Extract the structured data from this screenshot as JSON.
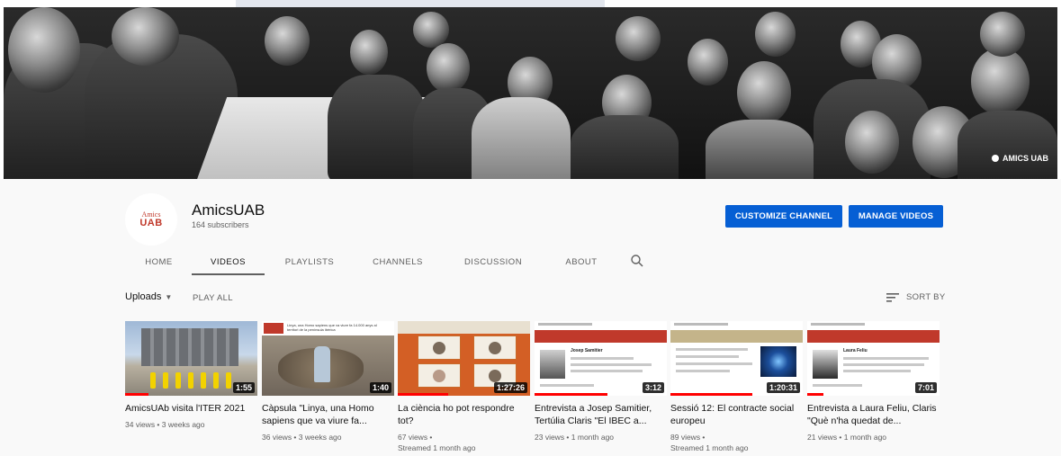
{
  "banner": {
    "watermark": "AMICS UAB"
  },
  "channel": {
    "avatar_line1": "Amics",
    "avatar_line2": "UAB",
    "name": "AmicsUAB",
    "subscribers": "164 subscribers"
  },
  "buttons": {
    "customize": "CUSTOMIZE CHANNEL",
    "manage": "MANAGE VIDEOS"
  },
  "tabs": [
    {
      "label": "HOME",
      "active": false
    },
    {
      "label": "VIDEOS",
      "active": true
    },
    {
      "label": "PLAYLISTS",
      "active": false
    },
    {
      "label": "CHANNELS",
      "active": false
    },
    {
      "label": "DISCUSSION",
      "active": false
    },
    {
      "label": "ABOUT",
      "active": false
    }
  ],
  "toolbar": {
    "uploads": "Uploads",
    "play_all": "PLAY ALL",
    "sort_by": "SORT BY"
  },
  "videos": [
    {
      "title": "AmicsUAb visita l'ITER 2021",
      "meta1": "34 views • 3 weeks ago",
      "meta2": "",
      "duration": "1:55",
      "watched": 0.18,
      "thumb_caption": ""
    },
    {
      "title": "Càpsula \"Linya, una Homo sapiens que va viure fa...",
      "meta1": "36 views • 3 weeks ago",
      "meta2": "",
      "duration": "1:40",
      "watched": 0.0,
      "thumb_caption": "Linya, una Homo sapiens que va viure fa 14.000 anys al territori de la península ibèrica"
    },
    {
      "title": "La ciència ho pot respondre tot?",
      "meta1": "67 views •",
      "meta2": "Streamed 1 month ago",
      "duration": "1:27:26",
      "watched": 0.38,
      "thumb_caption": ""
    },
    {
      "title": "Entrevista a Josep Samitier, Tertúlia Claris \"El IBEC a...",
      "meta1": "23 views • 1 month ago",
      "meta2": "",
      "duration": "3:12",
      "watched": 0.55,
      "thumb_caption": "Josep Samitier"
    },
    {
      "title": "Sessió 12: El contracte social europeu",
      "meta1": "89 views •",
      "meta2": "Streamed 1 month ago",
      "duration": "1:20:31",
      "watched": 0.62,
      "thumb_caption": ""
    },
    {
      "title": "Entrevista a Laura Feliu, Claris \"Què n'ha quedat de...",
      "meta1": "21 views • 1 month ago",
      "meta2": "",
      "duration": "7:01",
      "watched": 0.12,
      "thumb_caption": "Laura Feliu"
    }
  ],
  "colors": {
    "accent_blue": "#065fd4",
    "progress_red": "#ff0000",
    "brand_red": "#c0392b"
  },
  "icons": {
    "search": "search-icon",
    "sort": "sort-icon",
    "caret": "caret-down-icon"
  }
}
